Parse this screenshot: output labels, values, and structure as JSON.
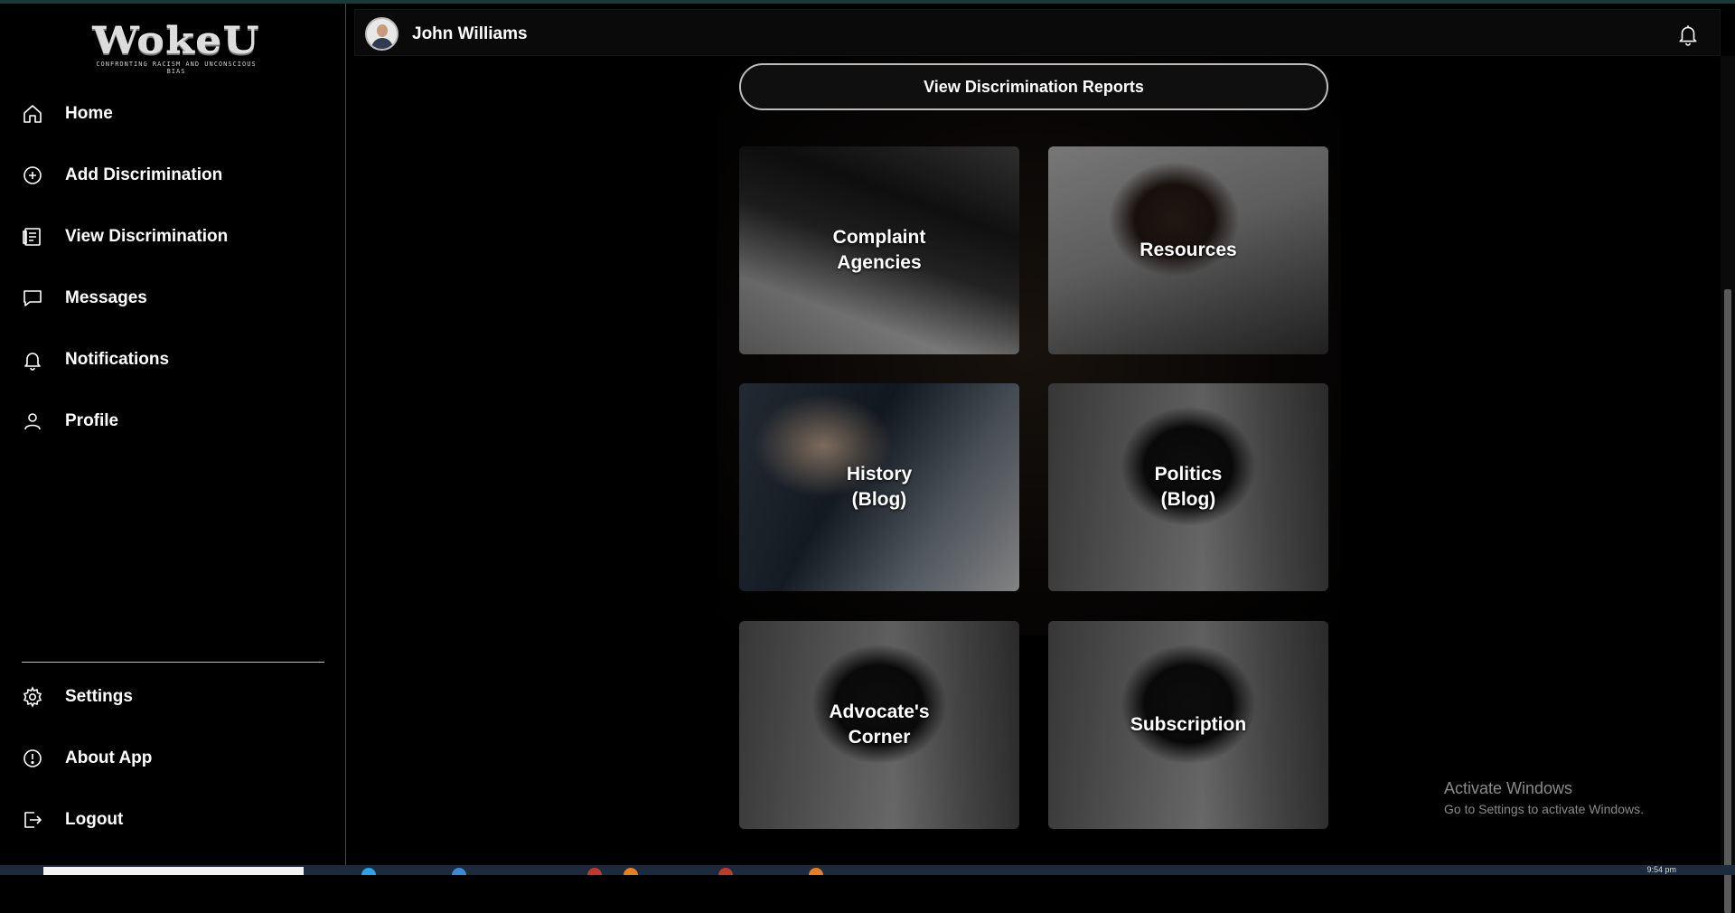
{
  "app": {
    "logo_text": "WokeU",
    "logo_tagline": "CONFRONTING RACISM AND UNCONSCIOUS BIAS"
  },
  "sidebar": {
    "items": [
      {
        "label": "Home",
        "icon": "home-icon"
      },
      {
        "label": "Add Discrimination",
        "icon": "plus-circle-icon"
      },
      {
        "label": "View Discrimination",
        "icon": "report-list-icon"
      },
      {
        "label": "Messages",
        "icon": "message-icon"
      },
      {
        "label": "Notifications",
        "icon": "bell-icon"
      },
      {
        "label": "Profile",
        "icon": "user-icon"
      }
    ],
    "bottom_items": [
      {
        "label": "Settings",
        "icon": "gear-icon"
      },
      {
        "label": "About App",
        "icon": "info-icon"
      },
      {
        "label": "Logout",
        "icon": "logout-icon"
      }
    ]
  },
  "header": {
    "username": "John Williams"
  },
  "main": {
    "reports_button": "View Discrimination Reports",
    "cards": [
      {
        "label": "Complaint\nAgencies"
      },
      {
        "label": "Resources"
      },
      {
        "label": "History\n(Blog)"
      },
      {
        "label": "Politics\n(Blog)"
      },
      {
        "label": "Advocate's\nCorner"
      },
      {
        "label": "Subscription"
      }
    ]
  },
  "watermark": {
    "title": "Activate Windows",
    "subtitle": "Go to Settings to activate Windows."
  },
  "taskbar": {
    "clock": "9:54 pm"
  }
}
